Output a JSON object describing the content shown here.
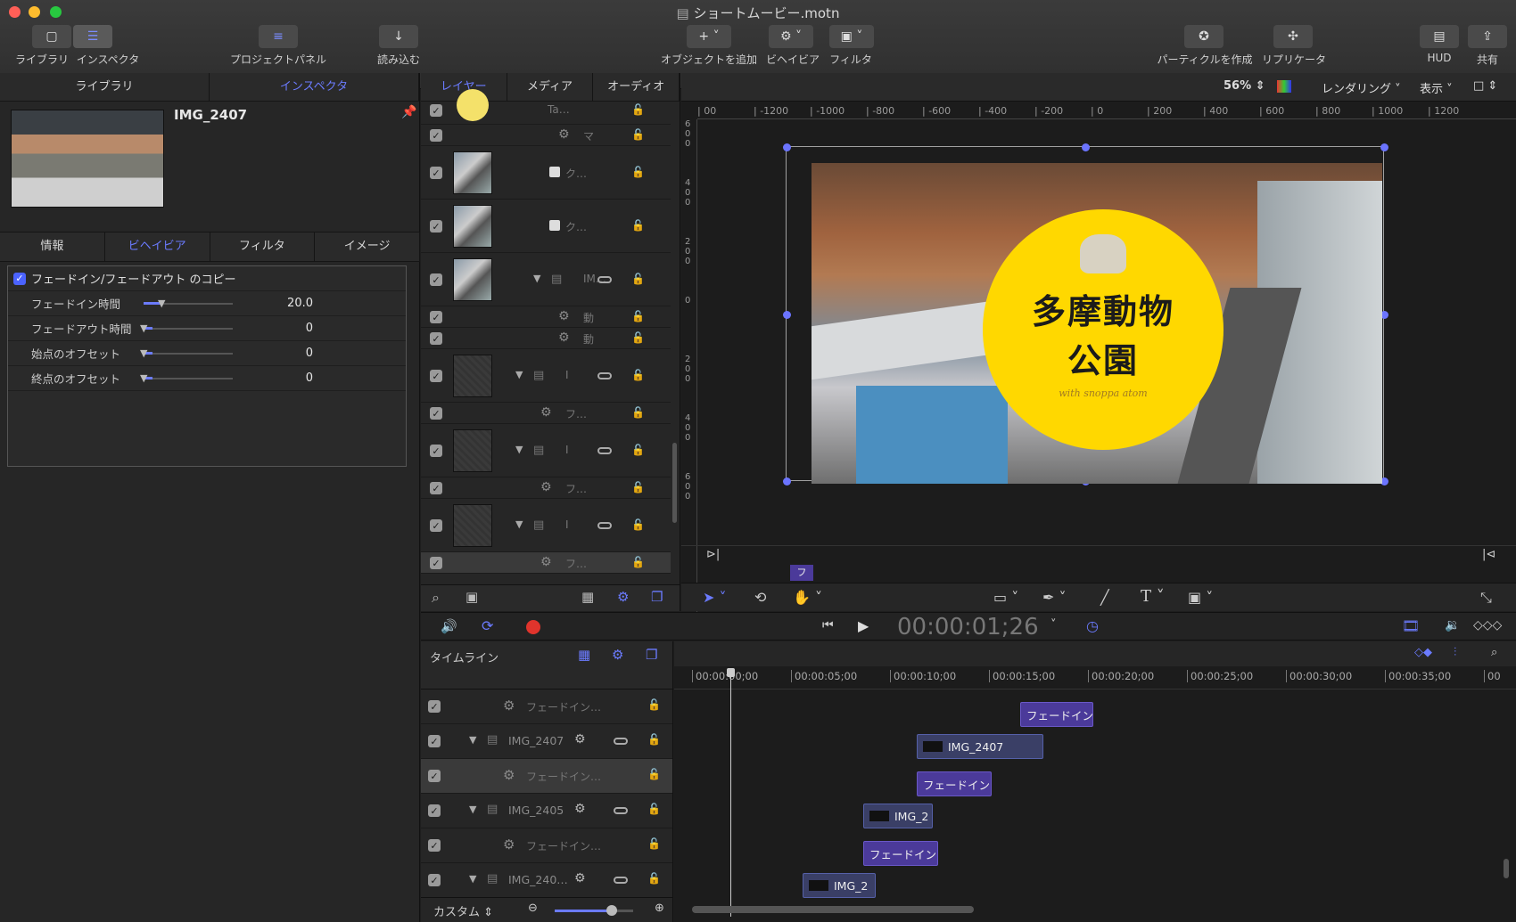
{
  "window": {
    "title": "ショートムービー.motn"
  },
  "toolbar": {
    "library": "ライブラリ",
    "inspector": "インスペクタ",
    "project_panel": "プロジェクトパネル",
    "import": "読み込む",
    "add_object": "オブジェクトを追加",
    "behavior": "ビヘイビア",
    "filter": "フィルタ",
    "particle": "パーティクルを作成",
    "replicator": "リプリケータ",
    "hud": "HUD",
    "share": "共有"
  },
  "left_panel": {
    "tab_library": "ライブラリ",
    "tab_inspector": "インスペクタ",
    "item_name": "IMG_2407",
    "subtabs": [
      "情報",
      "ビヘイビア",
      "フィルタ",
      "イメージ"
    ],
    "behavior_title": "フェードイン/フェードアウト のコピー",
    "params": [
      {
        "label": "フェードイン時間",
        "value": "20.0",
        "fraction": 0.2
      },
      {
        "label": "フェードアウト時間",
        "value": "0",
        "fraction": 0
      },
      {
        "label": "始点のオフセット",
        "value": "0",
        "fraction": 0
      },
      {
        "label": "終点のオフセット",
        "value": "0",
        "fraction": 0
      }
    ]
  },
  "layers_panel": {
    "tabs": [
      "レイヤー",
      "メディア",
      "オーディオ"
    ],
    "rows": [
      {
        "name": "Ta…"
      },
      {
        "name": "マ"
      },
      {
        "name": "ク…"
      },
      {
        "name": "ク…"
      },
      {
        "name": "IM…"
      },
      {
        "name": "動"
      },
      {
        "name": "動"
      },
      {
        "name": "I"
      },
      {
        "name": "フ…"
      },
      {
        "name": "I"
      },
      {
        "name": "フ…"
      },
      {
        "name": "I"
      },
      {
        "name": "フ…"
      }
    ]
  },
  "canvas": {
    "zoom": "56%",
    "rendering": "レンダリング",
    "view": "表示",
    "ruler_h": [
      "00",
      "-1200",
      "-1000",
      "-800",
      "-600",
      "-400",
      "-200",
      "0",
      "200",
      "400",
      "600",
      "800",
      "1000",
      "1200"
    ],
    "ruler_v": [
      "600",
      "400",
      "200",
      "0",
      "200",
      "400",
      "600"
    ],
    "logo_line1": "多摩動物",
    "logo_line2": "公園",
    "logo_sub": "with snoppa atom",
    "marker": "フ"
  },
  "transport": {
    "timecode": "00:00:01;26"
  },
  "timeline": {
    "label": "タイムライン",
    "zoom_label": "カスタム",
    "ticks": [
      "00:00:00;00",
      "00:00:05;00",
      "00:00:10;00",
      "00:00:15;00",
      "00:00:20;00",
      "00:00:25;00",
      "00:00:30;00",
      "00:00:35;00",
      "00"
    ],
    "rows": [
      {
        "name": "フェードイン…"
      },
      {
        "name": "IMG_2407"
      },
      {
        "name": "フェードイン…"
      },
      {
        "name": "IMG_2405"
      },
      {
        "name": "フェードイン…"
      },
      {
        "name": "IMG_240…"
      }
    ],
    "clips": [
      "フェードイン",
      "IMG_2407",
      "フェードイン",
      "IMG_2",
      "フェードイン",
      "IMG_2"
    ]
  },
  "colors": {
    "accent": "#6b7bff",
    "clip": "#4b3a9a",
    "logo_yellow": "#ffd800",
    "record": "#e0342c"
  }
}
